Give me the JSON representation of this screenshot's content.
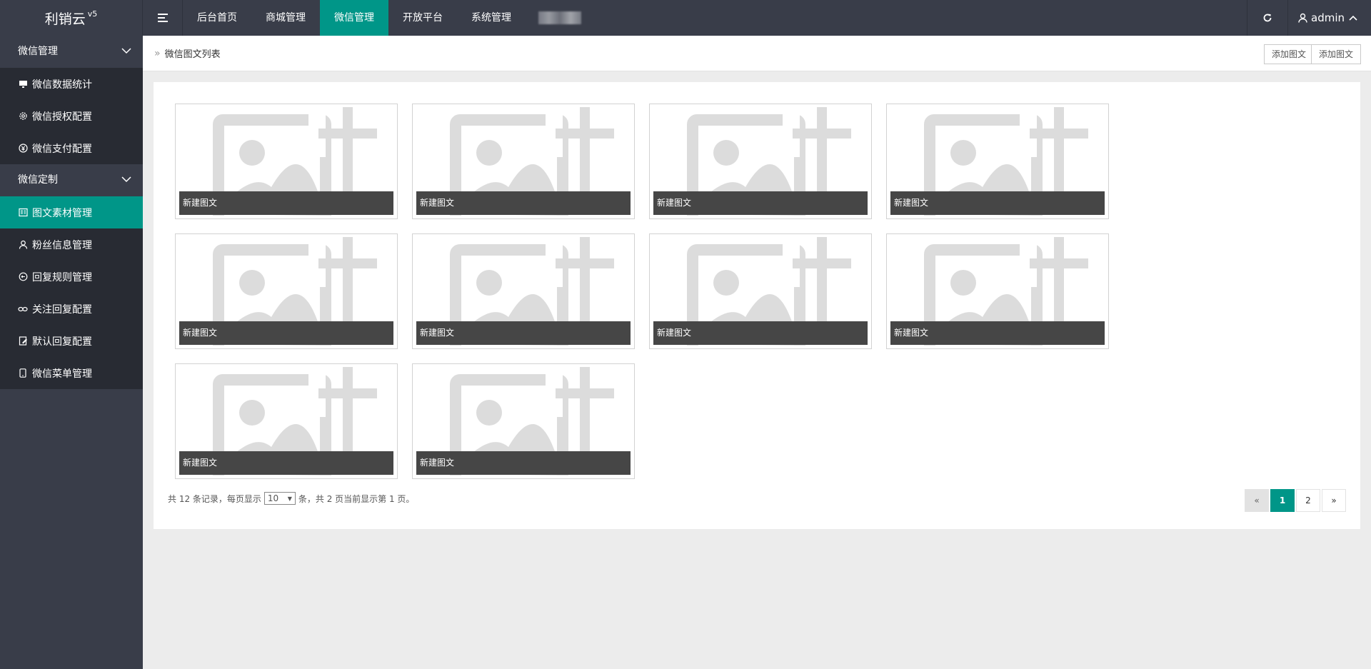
{
  "brand": {
    "name": "利销云",
    "version": "v5"
  },
  "topnav": {
    "items": [
      {
        "label": "后台首页",
        "active": false
      },
      {
        "label": "商城管理",
        "active": false
      },
      {
        "label": "微信管理",
        "active": true
      },
      {
        "label": "开放平台",
        "active": false
      },
      {
        "label": "系统管理",
        "active": false
      }
    ],
    "user": "admin",
    "accent_color": "#009688"
  },
  "sidebar": {
    "groups": [
      {
        "title": "微信管理",
        "items": [
          {
            "label": "微信数据统计",
            "icon": "monitor-icon"
          },
          {
            "label": "微信授权配置",
            "icon": "gear-icon"
          },
          {
            "label": "微信支付配置",
            "icon": "yen-circle-icon"
          }
        ]
      },
      {
        "title": "微信定制",
        "items": [
          {
            "label": "图文素材管理",
            "icon": "news-icon",
            "active": true
          },
          {
            "label": "粉丝信息管理",
            "icon": "user-icon"
          },
          {
            "label": "回复规则管理",
            "icon": "reply-icon"
          },
          {
            "label": "关注回复配置",
            "icon": "link-icon"
          },
          {
            "label": "默认回复配置",
            "icon": "edit-doc-icon"
          },
          {
            "label": "微信菜单管理",
            "icon": "phone-icon"
          }
        ]
      }
    ]
  },
  "breadcrumb": "微信图文列表",
  "header_buttons": [
    "添加图文",
    "添加图文"
  ],
  "cards": [
    {
      "caption": "新建图文"
    },
    {
      "caption": "新建图文"
    },
    {
      "caption": "新建图文"
    },
    {
      "caption": "新建图文"
    },
    {
      "caption": "新建图文"
    },
    {
      "caption": "新建图文"
    },
    {
      "caption": "新建图文"
    },
    {
      "caption": "新建图文"
    },
    {
      "caption": "新建图文"
    },
    {
      "caption": "新建图文"
    }
  ],
  "pagination": {
    "summary_prefix": "共 12 条记录，每页显示",
    "page_size": "10",
    "summary_suffix": "条，共 2 页当前显示第 1 页。",
    "prev": "«",
    "pages": [
      "1",
      "2"
    ],
    "current": "1",
    "next": "»"
  }
}
